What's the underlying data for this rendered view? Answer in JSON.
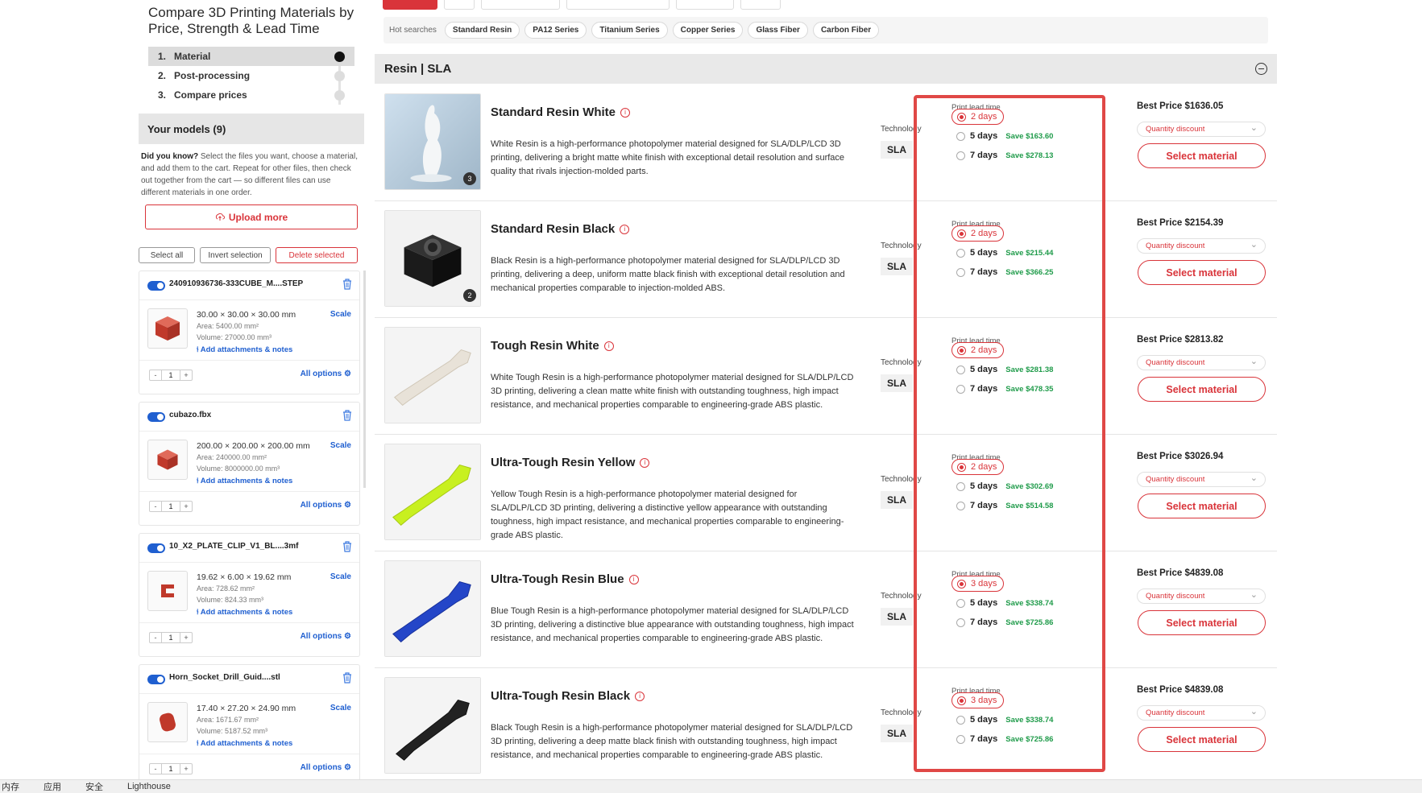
{
  "page_title": "Compare 3D Printing Materials by Price, Strength & Lead Time",
  "steps": [
    {
      "num": "1.",
      "label": "Material"
    },
    {
      "num": "2.",
      "label": "Post-processing"
    },
    {
      "num": "3.",
      "label": "Compare prices"
    }
  ],
  "models_header": "Your models (9)",
  "tip_bold": "Did you know?",
  "tip_text": " Select the files you want, choose a material, and add them to the cart. Repeat for other files, then check out together from the cart — so different files can use different materials in one order.",
  "upload_label": "Upload more",
  "selection": {
    "select_all": "Select all",
    "invert": "Invert selection",
    "delete": "Delete selected"
  },
  "models": [
    {
      "file": "240910936736-333CUBE_M....STEP",
      "dims": "30.00 × 30.00 × 30.00 mm",
      "area": "Area: 5400.00 mm²",
      "volume": "Volume: 27000.00 mm³",
      "scale": "Scale",
      "attach": "Add attachments & notes",
      "qty": "1",
      "options": "All options"
    },
    {
      "file": "cubazo.fbx",
      "dims": "200.00 × 200.00 × 200.00 mm",
      "area": "Area: 240000.00 mm²",
      "volume": "Volume: 8000000.00 mm³",
      "scale": "Scale",
      "attach": "Add attachments & notes",
      "qty": "1",
      "options": "All options"
    },
    {
      "file": "10_X2_PLATE_CLIP_V1_BL....3mf",
      "dims": "19.62 × 6.00 × 19.62 mm",
      "area": "Area: 728.62 mm²",
      "volume": "Volume: 824.33 mm³",
      "scale": "Scale",
      "attach": "Add attachments & notes",
      "qty": "1",
      "options": "All options"
    },
    {
      "file": "Horn_Socket_Drill_Guid....stl",
      "dims": "17.40 × 27.20 × 24.90 mm",
      "area": "Area: 1671.67 mm²",
      "volume": "Volume: 5187.52 mm³",
      "scale": "Scale",
      "attach": "Add attachments & notes",
      "qty": "1",
      "options": "All options"
    }
  ],
  "hot_searches": {
    "label": "Hot searches",
    "chips": [
      "Standard Resin",
      "PA12 Series",
      "Titanium Series",
      "Copper Series",
      "Glass Fiber",
      "Carbon Fiber"
    ]
  },
  "section_title": "Resin | SLA",
  "labels": {
    "technology": "Technology",
    "lead_time": "Print lead time",
    "quantity_discount": "Quantity discount",
    "select_material": "Select material"
  },
  "materials": [
    {
      "name": "Standard Resin White",
      "badge": "3",
      "desc": "White Resin is a high-performance photopolymer material designed for SLA/DLP/LCD 3D printing, delivering a bright matte white finish with exceptional detail resolution and surface quality that rivals injection-molded parts.",
      "tech": "SLA",
      "lead": [
        {
          "days": "2 days",
          "save": ""
        },
        {
          "days": "5 days",
          "save": "Save $163.60"
        },
        {
          "days": "7 days",
          "save": "Save $278.13"
        }
      ],
      "price": "Best Price $1636.05"
    },
    {
      "name": "Standard Resin Black",
      "badge": "2",
      "desc": "Black Resin is a high-performance photopolymer material designed for SLA/DLP/LCD 3D printing, delivering a deep, uniform matte black finish with exceptional detail resolution and mechanical properties comparable to injection-molded ABS.",
      "tech": "SLA",
      "lead": [
        {
          "days": "2 days",
          "save": ""
        },
        {
          "days": "5 days",
          "save": "Save $215.44"
        },
        {
          "days": "7 days",
          "save": "Save $366.25"
        }
      ],
      "price": "Best Price $2154.39"
    },
    {
      "name": "Tough Resin White",
      "badge": "",
      "desc": "White Tough Resin is a high-performance photopolymer material designed for SLA/DLP/LCD 3D printing, delivering a clean matte white finish with outstanding toughness, high impact resistance, and mechanical properties comparable to engineering-grade ABS plastic.",
      "tech": "SLA",
      "lead": [
        {
          "days": "2 days",
          "save": ""
        },
        {
          "days": "5 days",
          "save": "Save $281.38"
        },
        {
          "days": "7 days",
          "save": "Save $478.35"
        }
      ],
      "price": "Best Price $2813.82"
    },
    {
      "name": "Ultra-Tough Resin Yellow",
      "badge": "",
      "desc": "Yellow Tough Resin is a high-performance photopolymer material designed for SLA/DLP/LCD 3D printing, delivering a distinctive yellow appearance with outstanding toughness, high impact resistance, and mechanical properties comparable to engineering-grade ABS plastic.",
      "tech": "SLA",
      "lead": [
        {
          "days": "2 days",
          "save": ""
        },
        {
          "days": "5 days",
          "save": "Save $302.69"
        },
        {
          "days": "7 days",
          "save": "Save $514.58"
        }
      ],
      "price": "Best Price $3026.94"
    },
    {
      "name": "Ultra-Tough Resin Blue",
      "badge": "",
      "desc": "Blue Tough Resin is a high-performance photopolymer material designed for SLA/DLP/LCD 3D printing, delivering a distinctive blue appearance with outstanding toughness, high impact resistance, and mechanical properties comparable to engineering-grade ABS plastic.",
      "tech": "SLA",
      "lead": [
        {
          "days": "3 days",
          "save": ""
        },
        {
          "days": "5 days",
          "save": "Save $338.74"
        },
        {
          "days": "7 days",
          "save": "Save $725.86"
        }
      ],
      "price": "Best Price $4839.08"
    },
    {
      "name": "Ultra-Tough Resin Black",
      "badge": "",
      "desc": "Black Tough Resin is a high-performance photopolymer material designed for SLA/DLP/LCD 3D printing, delivering a deep matte black finish with outstanding toughness, high impact resistance, and mechanical properties comparable to engineering-grade ABS plastic.",
      "tech": "SLA",
      "lead": [
        {
          "days": "3 days",
          "save": ""
        },
        {
          "days": "5 days",
          "save": "Save $338.74"
        },
        {
          "days": "7 days",
          "save": "Save $725.86"
        }
      ],
      "price": "Best Price $4839.08"
    }
  ],
  "bottom_bar": [
    "内存",
    "应用",
    "安全",
    "Lighthouse"
  ],
  "colors": {
    "accent": "#d9343a",
    "link": "#1f5fd0",
    "save_green": "#1f9b4a"
  }
}
